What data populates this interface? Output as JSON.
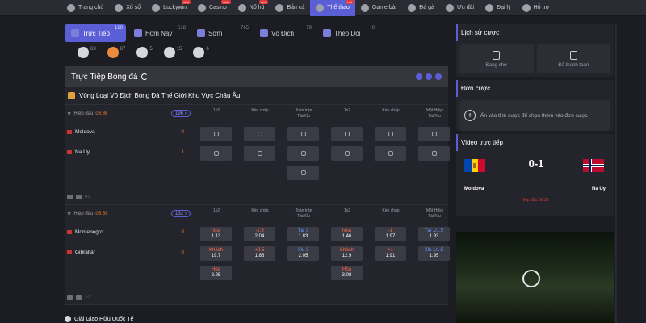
{
  "nav": [
    {
      "label": "Trang chủ",
      "hot": "",
      "active": false
    },
    {
      "label": "Xổ số",
      "hot": "",
      "active": false
    },
    {
      "label": "Luckywin",
      "hot": "new",
      "active": false
    },
    {
      "label": "Casino",
      "hot": "new",
      "active": false
    },
    {
      "label": "Nổ hũ",
      "hot": "new",
      "active": false
    },
    {
      "label": "Bắn cá",
      "hot": "",
      "active": false
    },
    {
      "label": "Thể thao",
      "hot": "hot",
      "active": true
    },
    {
      "label": "Game bài",
      "hot": "",
      "active": false
    },
    {
      "label": "Đá gà",
      "hot": "",
      "active": false
    },
    {
      "label": "Ưu đãi",
      "hot": "",
      "active": false
    },
    {
      "label": "Đại lý",
      "hot": "",
      "active": false
    },
    {
      "label": "Hỗ trợ",
      "hot": "",
      "active": false
    }
  ],
  "tabs": [
    {
      "label": "Trực Tiếp",
      "count": "160",
      "active": true
    },
    {
      "label": "Hôm Nay",
      "count": "518",
      "active": false
    },
    {
      "label": "Sớm",
      "count": "765",
      "active": false
    },
    {
      "label": "Vô Địch",
      "count": "79",
      "active": false
    },
    {
      "label": "Theo Dõi",
      "count": "0",
      "active": false
    }
  ],
  "sports": [
    {
      "icon": "soccer-ball-icon",
      "count": "63"
    },
    {
      "icon": "basketball-icon",
      "count": "67"
    },
    {
      "icon": "baseball-icon",
      "count": "5"
    },
    {
      "icon": "volleyball-icon",
      "count": "15"
    },
    {
      "icon": "badminton-icon",
      "count": "6"
    }
  ],
  "section_title": "Trực Tiếp Bóng đá",
  "league_title": "Vòng Loại Vô Địch Bóng Đá Thế Giới Khu Vực Châu Âu",
  "columns": [
    "1x2",
    "Kèo chấp",
    "Toàn trận\nTài/Xỉu",
    "1x2",
    "Kèo chấp",
    "Một Hiệp\nTài/Xỉu"
  ],
  "match1": {
    "h2h": "Hiệp đầu",
    "time": "06:36",
    "more": "196",
    "home": "Moldova",
    "home_score": "0",
    "away": "Na Uy",
    "away_score": "1",
    "foot": "0-0"
  },
  "match2": {
    "h2h": "Hiệp đầu",
    "time": "05:59",
    "more": "132",
    "home": "Montenegro",
    "home_score": "0",
    "away": "Gibraltar",
    "away_score": "0",
    "foot": "1-1",
    "odds": [
      {
        "top": "Nhà",
        "val": "1.13"
      },
      {
        "top": "-2.5",
        "val": "2.04"
      },
      {
        "top": "Tài 3",
        "val": "1.83"
      },
      {
        "top": "Nhà",
        "val": "1.46"
      },
      {
        "top": "-1",
        "val": "1.97"
      },
      {
        "top": "Tài 1/1.5",
        "val": "1.93"
      },
      {
        "top": "Khách",
        "val": "19.7"
      },
      {
        "top": "+2.5",
        "val": "1.86"
      },
      {
        "top": "Xỉu 3",
        "val": "2.05"
      },
      {
        "top": "Khách",
        "val": "12.9"
      },
      {
        "top": "+1",
        "val": "1.91"
      },
      {
        "top": "Xỉu 1/1.5",
        "val": "1.95"
      },
      {
        "top": "Hòa",
        "val": "8.25"
      },
      {
        "top": "Hòa",
        "val": "3.08"
      }
    ]
  },
  "league2": "Giải Giao Hữu Quốc Tế",
  "side": {
    "history_title": "Lịch sử cược",
    "history_pending": "Đang chờ",
    "history_paid": "Đã thanh toán",
    "bets_title": "Đơn cược",
    "bets_hint": "Ấn vào tỉ lệ cược để chọn thêm vào đơn cược",
    "video_title": "Video trực tiếp",
    "score": "0-1",
    "home": "Moldova",
    "away": "Na Uy",
    "status": "Hiệp đầu 06:36"
  },
  "colors": {
    "accent": "#5b5fd6",
    "live": "#f07a2a",
    "odds_home": "#ff6a4a"
  }
}
